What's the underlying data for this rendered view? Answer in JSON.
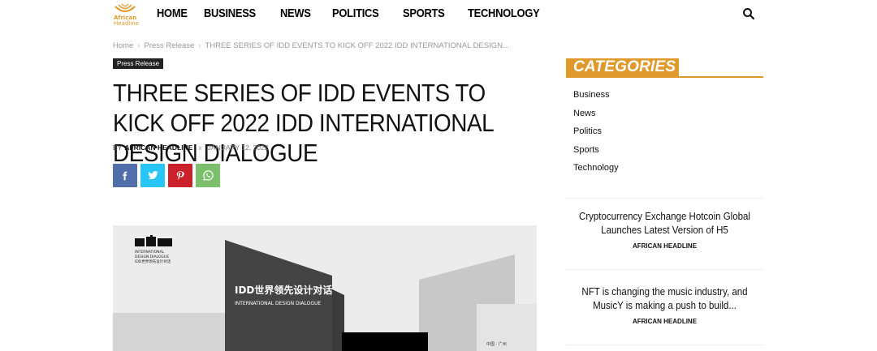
{
  "site": {
    "logo_line1": "African",
    "logo_line2": "Headline"
  },
  "nav": {
    "items": [
      "HOME",
      "BUSINESS",
      "NEWS",
      "POLITICS",
      "SPORTS",
      "TECHNOLOGY"
    ]
  },
  "breadcrumb": {
    "home": "Home",
    "section": "Press Release",
    "current": "THREE SERIES OF IDD EVENTS TO KICK OFF 2022 IDD INTERNATIONAL DESIGN..."
  },
  "article": {
    "category": "Press Release",
    "title": "THREE SERIES OF IDD EVENTS TO KICK OFF 2022 IDD INTERNATIONAL DESIGN DIALOGUE",
    "by": "BY",
    "author": "AFRICAN HEADLINE",
    "separator": "x",
    "date": "JANUARY 12, 2022",
    "share_icons": [
      "facebook-icon",
      "twitter-icon",
      "pinterest-icon",
      "whatsapp-icon"
    ],
    "hero": {
      "logo_line1": "INTERNATIONAL",
      "logo_line2": "DESIGN DIALOGUE",
      "logo_line3": "IDD世界领先设计对话",
      "center_cn": "IDD世界领先设计对话",
      "center_en": "INTERNATIONAL DESIGN DIALOGUE",
      "right_cn": "中国 · 广州"
    }
  },
  "sidebar": {
    "categories_heading": "CATEGORIES",
    "categories": [
      "Business",
      "News",
      "Politics",
      "Sports",
      "Technology"
    ],
    "posts": [
      {
        "title": "Cryptocurrency Exchange Hotcoin Global Launches Latest Version of H5",
        "author": "AFRICAN HEADLINE"
      },
      {
        "title": "NFT is changing the music industry, and MusicY is making a push to build...",
        "author": "AFRICAN HEADLINE"
      }
    ]
  },
  "colors": {
    "accent": "#e09a2c",
    "facebook": "#516eab",
    "twitter": "#29c5f6",
    "pinterest": "#ca212a",
    "whatsapp": "#7bbf6a"
  }
}
